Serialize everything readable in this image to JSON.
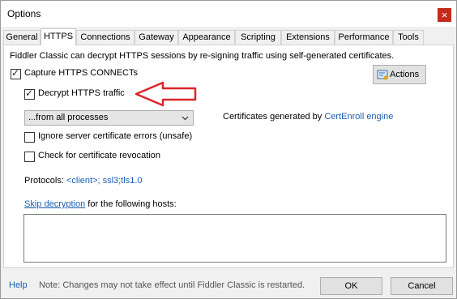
{
  "window": {
    "title": "Options",
    "close_glyph": "×"
  },
  "tabs": [
    "General",
    "HTTPS",
    "Connections",
    "Gateway",
    "Appearance",
    "Scripting",
    "Extensions",
    "Performance",
    "Tools"
  ],
  "active_tab": "HTTPS",
  "https": {
    "description": "Fiddler Classic can decrypt HTTPS sessions by re-signing traffic using self-generated certificates.",
    "capture_label": "Capture HTTPS CONNECTs",
    "capture_checked": true,
    "actions_label": "Actions",
    "decrypt_label": "Decrypt HTTPS traffic",
    "decrypt_checked": true,
    "process_filter_value": "...from all processes",
    "cert_prefix": "Certificates generated by ",
    "cert_engine": "CertEnroll engine",
    "ignore_label": "Ignore server certificate errors (unsafe)",
    "ignore_checked": false,
    "revocation_label": "Check for certificate revocation",
    "revocation_checked": false,
    "protocols_label": "Protocols: ",
    "protocols_value": "<client>; ssl3;tls1.0",
    "skip_link": "Skip decryption",
    "skip_suffix": " for the following hosts:",
    "hosts_value": ""
  },
  "footer": {
    "help": "Help",
    "note": "Note: Changes may not take effect until Fiddler Classic is restarted.",
    "ok": "OK",
    "cancel": "Cancel"
  },
  "colors": {
    "annotation_arrow": "#d9262c",
    "link": "#1a5fb4",
    "close": "#c42b1c"
  }
}
